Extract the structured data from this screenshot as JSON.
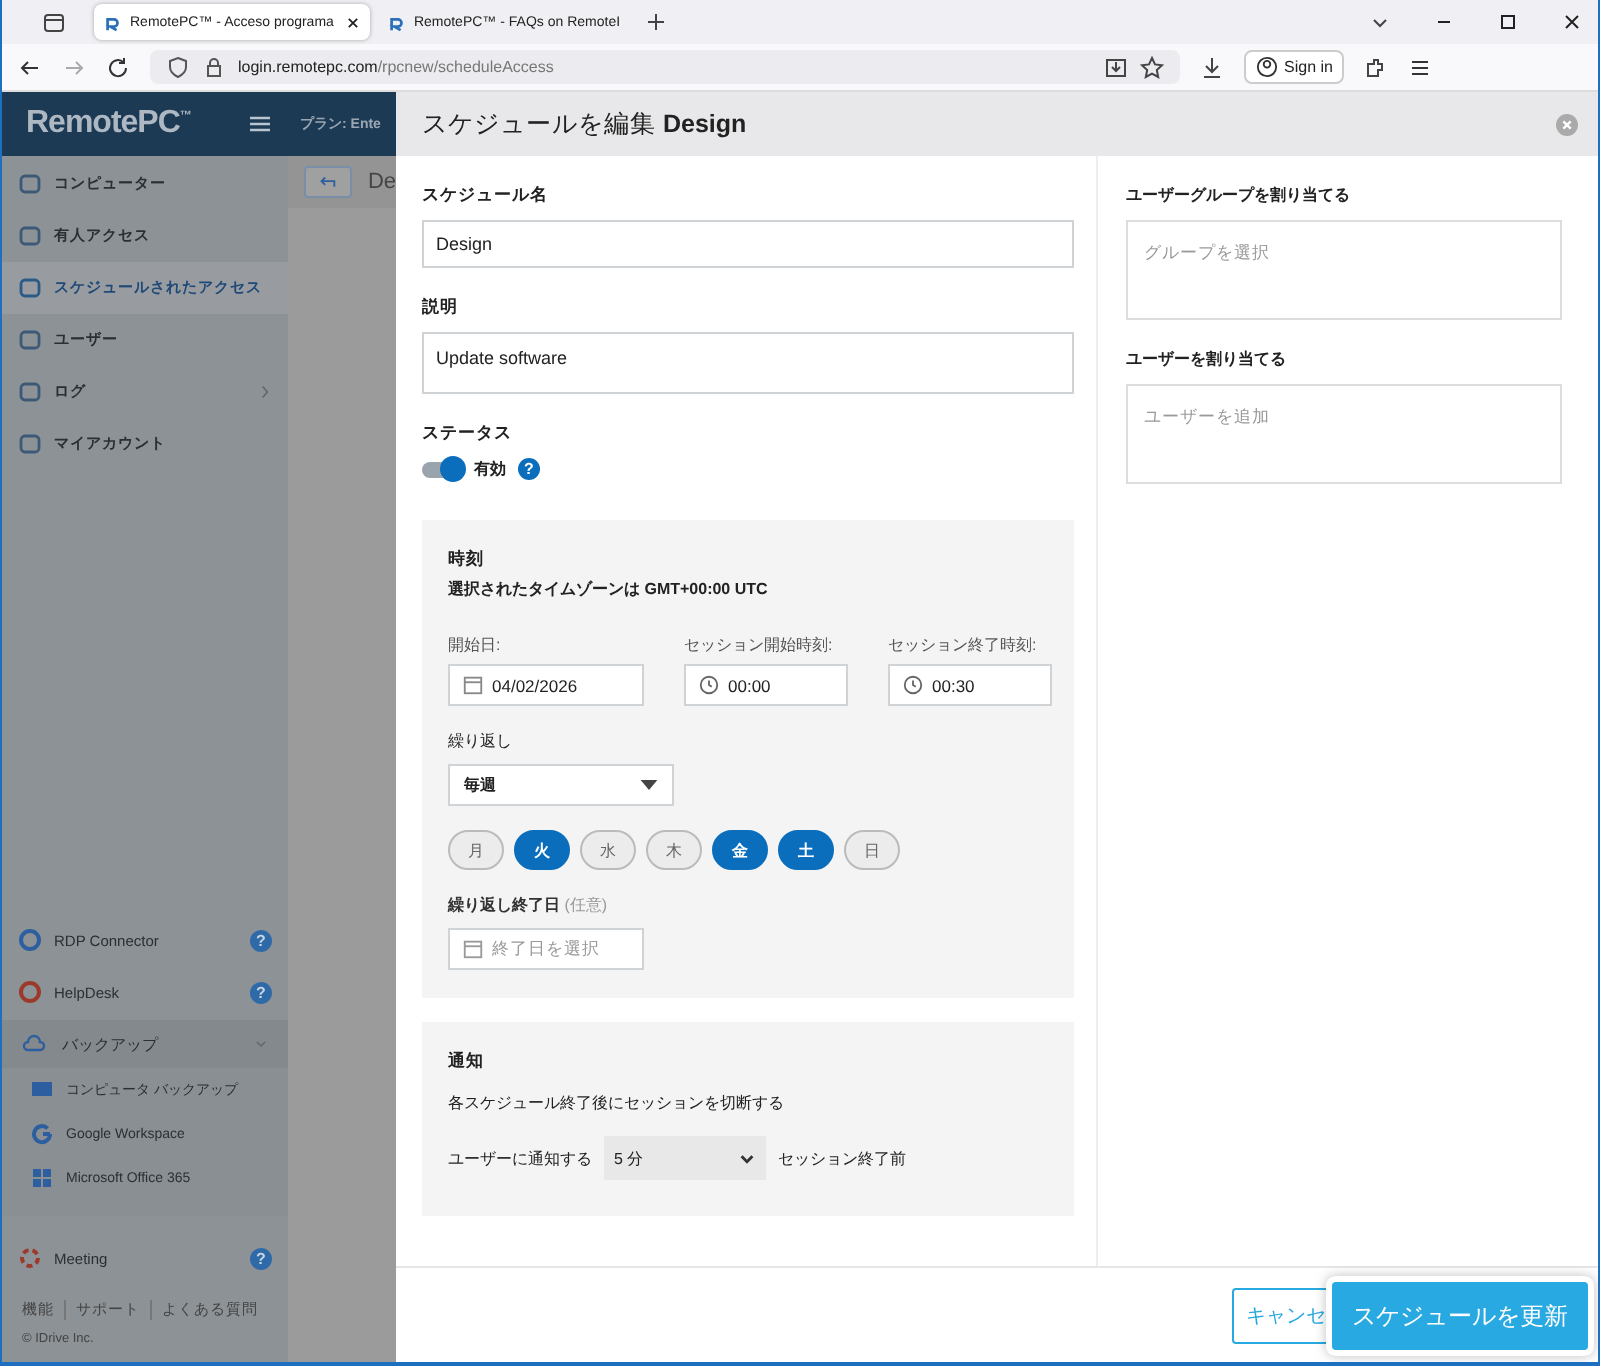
{
  "browser": {
    "tabs": [
      {
        "title": "RemotePC™ - Acceso programa",
        "selected": true
      },
      {
        "title": "RemotePC™ - FAQs on RemoteI",
        "selected": false
      }
    ],
    "url_host": "login.remotepc.com",
    "url_path": "/rpcnew/scheduleAccess",
    "sign_in": "Sign in"
  },
  "app": {
    "logo": "RemotePC",
    "logo_tm": "™",
    "plan": "プラン: Ente",
    "page_title": "De"
  },
  "sidebar": {
    "items": [
      {
        "label": "コンピューター",
        "selected": false,
        "has_arrow": false
      },
      {
        "label": "有人アクセス",
        "selected": false,
        "has_arrow": false
      },
      {
        "label": "スケジュールされたアクセス",
        "selected": true,
        "has_arrow": false
      },
      {
        "label": "ユーザー",
        "selected": false,
        "has_arrow": false
      },
      {
        "label": "ログ",
        "selected": false,
        "has_arrow": true
      },
      {
        "label": "マイアカウント",
        "selected": false,
        "has_arrow": false
      }
    ],
    "tools": [
      {
        "label": "RDP Connector",
        "help": "?"
      },
      {
        "label": "HelpDesk",
        "help": "?"
      }
    ],
    "backup": {
      "label": "バックアップ",
      "expanded": true,
      "children": [
        {
          "label": "コンピュータ バックアップ"
        },
        {
          "label": "Google Workspace"
        },
        {
          "label": "Microsoft Office 365"
        }
      ]
    },
    "meeting": {
      "label": "Meeting",
      "help": "?"
    },
    "footer_links": [
      "機能",
      "サポート",
      "よくある質問"
    ],
    "copyright": "© IDrive Inc."
  },
  "modal": {
    "title": "スケジュールを編集 **Design**",
    "name_label": "スケジュール名",
    "name_value": "Design",
    "desc_label": "説明",
    "desc_value": "Update software",
    "status_label": "ステータス",
    "status_on": true,
    "status_text": "有効",
    "status_help": "?",
    "time": {
      "heading": "時刻",
      "timezone": "選択されたタイムゾーンは GMT+00:00 UTC",
      "start_date_label": "開始日:",
      "start_date": "04/02/2026",
      "start_time_label": "セッション開始時刻:",
      "start_time": "00:00",
      "end_time_label": "セッション終了時刻:",
      "end_time": "00:30",
      "repeat_label": "繰り返し",
      "repeat_value": "毎週",
      "days": [
        {
          "label": "月",
          "selected": false
        },
        {
          "label": "火",
          "selected": true
        },
        {
          "label": "水",
          "selected": false
        },
        {
          "label": "木",
          "selected": false
        },
        {
          "label": "金",
          "selected": true
        },
        {
          "label": "土",
          "selected": true
        },
        {
          "label": "日",
          "selected": false
        }
      ],
      "repeat_end_label": "繰り返し終了日",
      "repeat_end_optional": "(任意)",
      "repeat_end_placeholder": "終了日を選択"
    },
    "notify": {
      "heading": "通知",
      "text": "各スケジュール終了後にセッションを切断する",
      "prefix": "ユーザーに通知する",
      "value": "5 分",
      "suffix": "セッション終了前"
    },
    "group_label": "ユーザーグループを割り当てる",
    "group_placeholder": "グループを選択",
    "user_label": "ユーザーを割り当てる",
    "user_placeholder": "ユーザーを追加",
    "cancel": "キャンセ",
    "update": "スケジュールを更新"
  }
}
